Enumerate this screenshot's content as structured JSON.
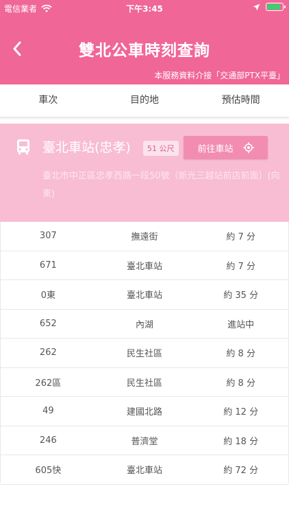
{
  "status": {
    "carrier": "電信業者",
    "time": "下午3:45"
  },
  "header": {
    "title": "雙北公車時刻查詢",
    "subtitle": "本服務資料介接「交通部PTX平臺」"
  },
  "columns": [
    "車次",
    "目的地",
    "預估時間"
  ],
  "stop": {
    "name": "臺北車站(忠孝)",
    "distance": "51 公尺",
    "go_label": "前往車站",
    "address": "臺北市中正區忠孝西路一段50號（新光三越站前店前面）(向東)"
  },
  "rows": [
    {
      "route": "307",
      "dest": "撫遠街",
      "eta": "約 7 分"
    },
    {
      "route": "671",
      "dest": "臺北車站",
      "eta": "約 7 分"
    },
    {
      "route": "0東",
      "dest": "臺北車站",
      "eta": "約 35 分"
    },
    {
      "route": "652",
      "dest": "內湖",
      "eta": "進站中"
    },
    {
      "route": "262",
      "dest": "民生社區",
      "eta": "約 8 分"
    },
    {
      "route": "262區",
      "dest": "民生社區",
      "eta": "約 8 分"
    },
    {
      "route": "49",
      "dest": "建國北路",
      "eta": "約 12 分"
    },
    {
      "route": "246",
      "dest": "普濟堂",
      "eta": "約 18 分"
    },
    {
      "route": "605快",
      "dest": "臺北車站",
      "eta": "約 72 分"
    }
  ],
  "colors": {
    "accent": "#f06696",
    "card": "#f8bdd2"
  }
}
